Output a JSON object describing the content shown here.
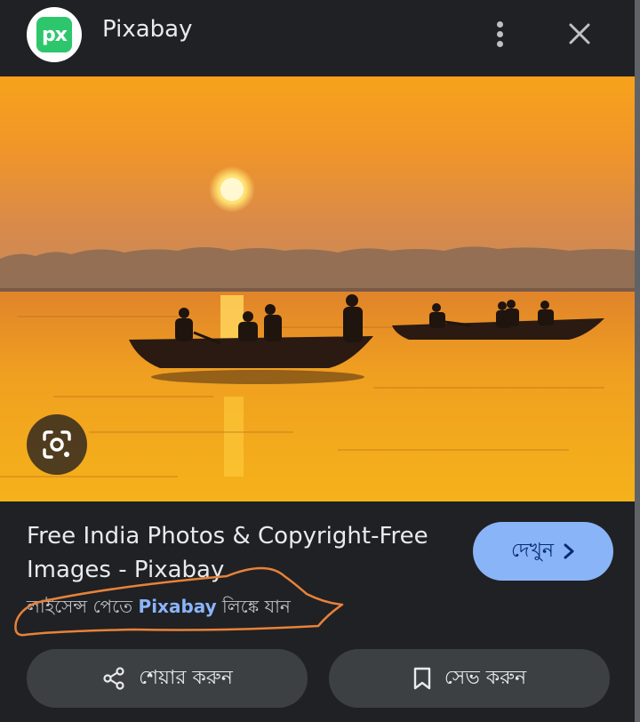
{
  "header": {
    "logo_text": "px",
    "site_name": "Pixabay",
    "menu_icon": "more-vert-icon",
    "close_icon": "close-icon"
  },
  "image": {
    "alt": "Sunset over river with boats",
    "lens_icon": "google-lens-icon"
  },
  "result": {
    "title": "Free India Photos & Copyright-Free Images - Pixabay",
    "license_prefix": "লাইসেন্স পেতে ",
    "license_link": "Pixabay",
    "license_suffix": " লিঙ্কে যান"
  },
  "buttons": {
    "view_label": "দেখুন",
    "share_label": "শেয়ার করুন",
    "save_label": "সেভ করুন"
  },
  "colors": {
    "background": "#202124",
    "accent": "#8ab4f8",
    "pixabay_green": "#2ec66d",
    "annotation": "#e8823a"
  }
}
